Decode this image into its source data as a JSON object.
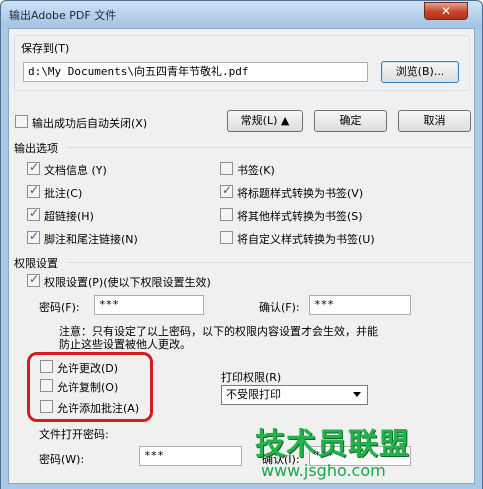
{
  "window": {
    "title": "输出Adobe PDF 文件",
    "close_glyph": "✕"
  },
  "save_to": {
    "label": "保存到(T)",
    "path": "d:\\My Documents\\向五四青年节敬礼.pdf",
    "browse_label": "浏览(B)..."
  },
  "auto_close": {
    "label": "输出成功后自动关闭(X)",
    "checked": false
  },
  "buttons": {
    "general": "常规(L) ▲",
    "ok": "确定",
    "cancel": "取消"
  },
  "output_options": {
    "heading": "输出选项",
    "left": [
      {
        "label": "文档信息 (Y)",
        "checked": true
      },
      {
        "label": "批注(C)",
        "checked": true
      },
      {
        "label": "超链接(H)",
        "checked": true
      },
      {
        "label": "脚注和尾注链接(N)",
        "checked": true
      }
    ],
    "right": [
      {
        "label": "书签(K)",
        "checked": false
      },
      {
        "label": "将标题样式转换为书签(V)",
        "checked": true
      },
      {
        "label": "将其他样式转换为书签(S)",
        "checked": false
      },
      {
        "label": "将自定义样式转换为书签(U)",
        "checked": false
      }
    ]
  },
  "permissions": {
    "heading": "权限设置",
    "enable_label": "权限设置(P)(使以下权限设置生效)",
    "enable_checked": true,
    "password_label": "密码(F):",
    "password_value": "***",
    "confirm_label": "确认(F):",
    "confirm_value": "***",
    "note": "注意：只有设定了以上密码，以下的权限内容设置才会生效，并能防止这些设置被他人更改。",
    "note_line1": "注意：只有设定了以上密码，以下的权限内容设置才会生效，并能",
    "note_line2": "防止这些设置被他人更改。",
    "allow": [
      {
        "label": "允许更改(D)",
        "checked": false
      },
      {
        "label": "允许复制(O)",
        "checked": false
      },
      {
        "label": "允许添加批注(A)",
        "checked": false
      }
    ],
    "print_label": "打印权限(R)",
    "print_value": "不受限打印",
    "open_pwd_heading": "文件打开密码:",
    "open_pwd_label": "密码(W):",
    "open_pwd_value": "***",
    "open_confirm_label": "确认(I):",
    "open_confirm_value": "***"
  },
  "watermark": {
    "logo_text": "技术员联盟",
    "url": "www.jsgho.com"
  }
}
